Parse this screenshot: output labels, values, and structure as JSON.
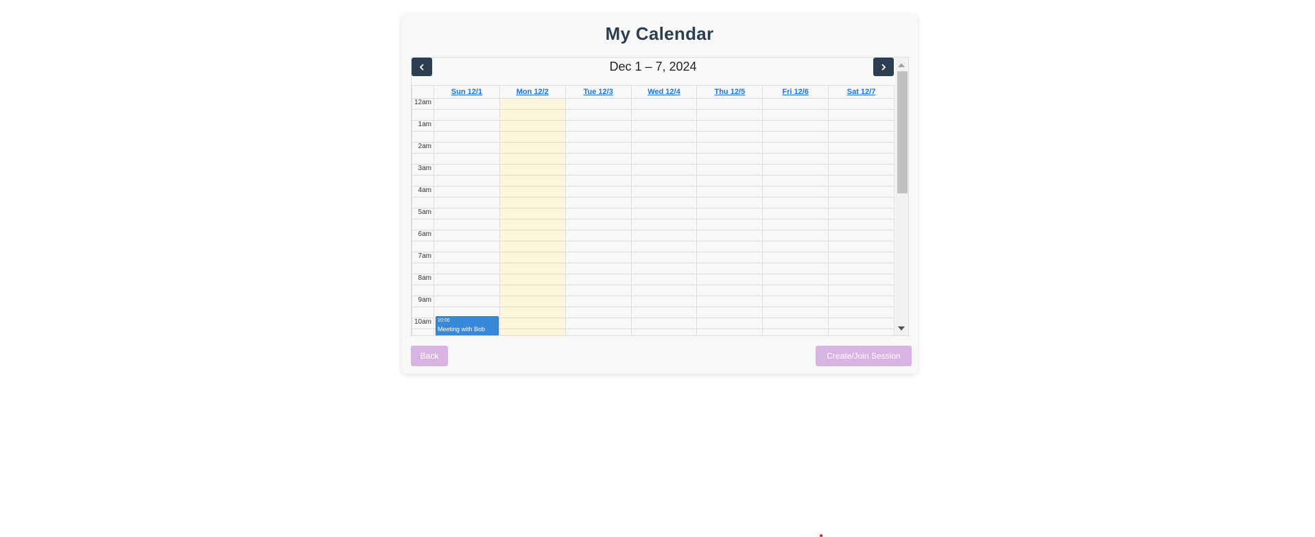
{
  "page": {
    "title": "My Calendar"
  },
  "calendar": {
    "range_title": "Dec 1 – 7, 2024",
    "prev_icon": "chevron-left-icon",
    "next_icon": "chevron-right-icon",
    "days": [
      {
        "label": "Sun 12/1",
        "today": false
      },
      {
        "label": "Mon 12/2",
        "today": true
      },
      {
        "label": "Tue 12/3",
        "today": false
      },
      {
        "label": "Wed 12/4",
        "today": false
      },
      {
        "label": "Thu 12/5",
        "today": false
      },
      {
        "label": "Fri 12/6",
        "today": false
      },
      {
        "label": "Sat 12/7",
        "today": false
      }
    ],
    "hours": [
      "12am",
      "1am",
      "2am",
      "3am",
      "4am",
      "5am",
      "6am",
      "7am",
      "8am",
      "9am",
      "10am"
    ],
    "events": [
      {
        "day": "Sun 12/1",
        "time": "10:00",
        "title": "Meeting with Bob",
        "color": "#3788d8"
      }
    ],
    "today_color": "#fcf6dc"
  },
  "actions": {
    "back_label": "Back",
    "session_label": "Create/Join Session",
    "button_color": "#d8b4e2"
  },
  "colors": {
    "title": "#2c3e50",
    "nav_button": "#2c3e50",
    "link": "#1a73e8"
  }
}
